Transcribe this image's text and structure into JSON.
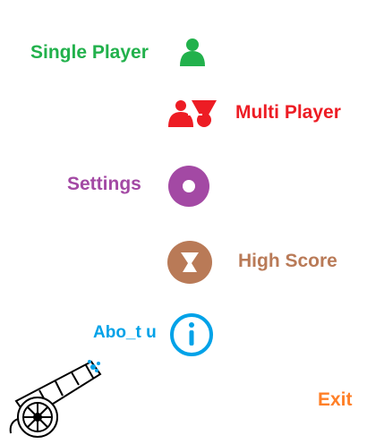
{
  "menu": {
    "single_player": "Single Player",
    "multi_player": "Multi Player",
    "settings": "Settings",
    "high_score": "High Score",
    "about": "Abo_t u",
    "exit": "Exit"
  },
  "icons": {
    "single_player": "person-icon",
    "multi_player": "group-icon",
    "settings": "ring-icon",
    "high_score": "hourglass-icon",
    "about": "info-icon",
    "decoration": "cannon-icon"
  },
  "colors": {
    "single_player": "#22b14c",
    "multi_player": "#ed1c24",
    "settings": "#a349a4",
    "high_score": "#b97a57",
    "about": "#00a2e8",
    "exit": "#ff7f27"
  }
}
